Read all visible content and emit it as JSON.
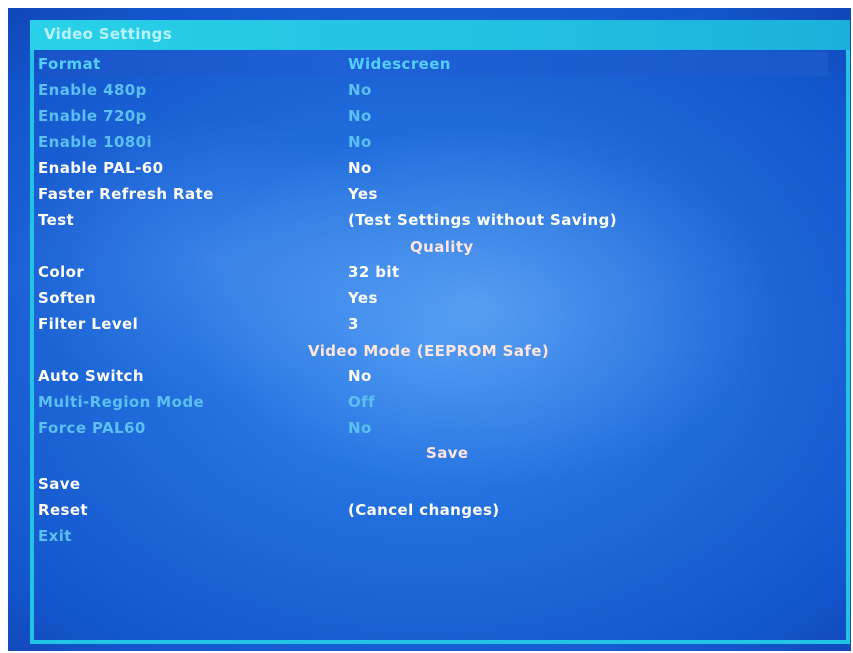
{
  "window": {
    "title": "Video Settings"
  },
  "rows": [
    {
      "label": "Format",
      "value": "Widescreen"
    },
    {
      "label": "Enable 480p",
      "value": "No"
    },
    {
      "label": "Enable 720p",
      "value": "No"
    },
    {
      "label": "Enable 1080i",
      "value": "No"
    },
    {
      "label": "Enable PAL-60",
      "value": "No"
    },
    {
      "label": "Faster Refresh Rate",
      "value": "Yes"
    },
    {
      "label": "Test",
      "value": "(Test Settings without Saving)"
    },
    {
      "label": "Color",
      "value": "32 bit"
    },
    {
      "label": "Soften",
      "value": "Yes"
    },
    {
      "label": "Filter Level",
      "value": "3"
    },
    {
      "label": "Auto Switch",
      "value": "No"
    },
    {
      "label": "Multi-Region Mode",
      "value": "Off"
    },
    {
      "label": "Force PAL60",
      "value": "No"
    },
    {
      "label": "Save",
      "value": ""
    },
    {
      "label": "Reset",
      "value": "(Cancel changes)"
    },
    {
      "label": "Exit",
      "value": ""
    }
  ],
  "sections": {
    "quality": "Quality",
    "video_mode": "Video Mode (EEPROM Safe)",
    "save": "Save"
  },
  "colors": {
    "background": "#1a5fd4",
    "title_bar": "#22c4e6",
    "enabled_text": "#ffffff",
    "disabled_text": "#5cc0f2",
    "section_text": "#ffe6e0"
  }
}
